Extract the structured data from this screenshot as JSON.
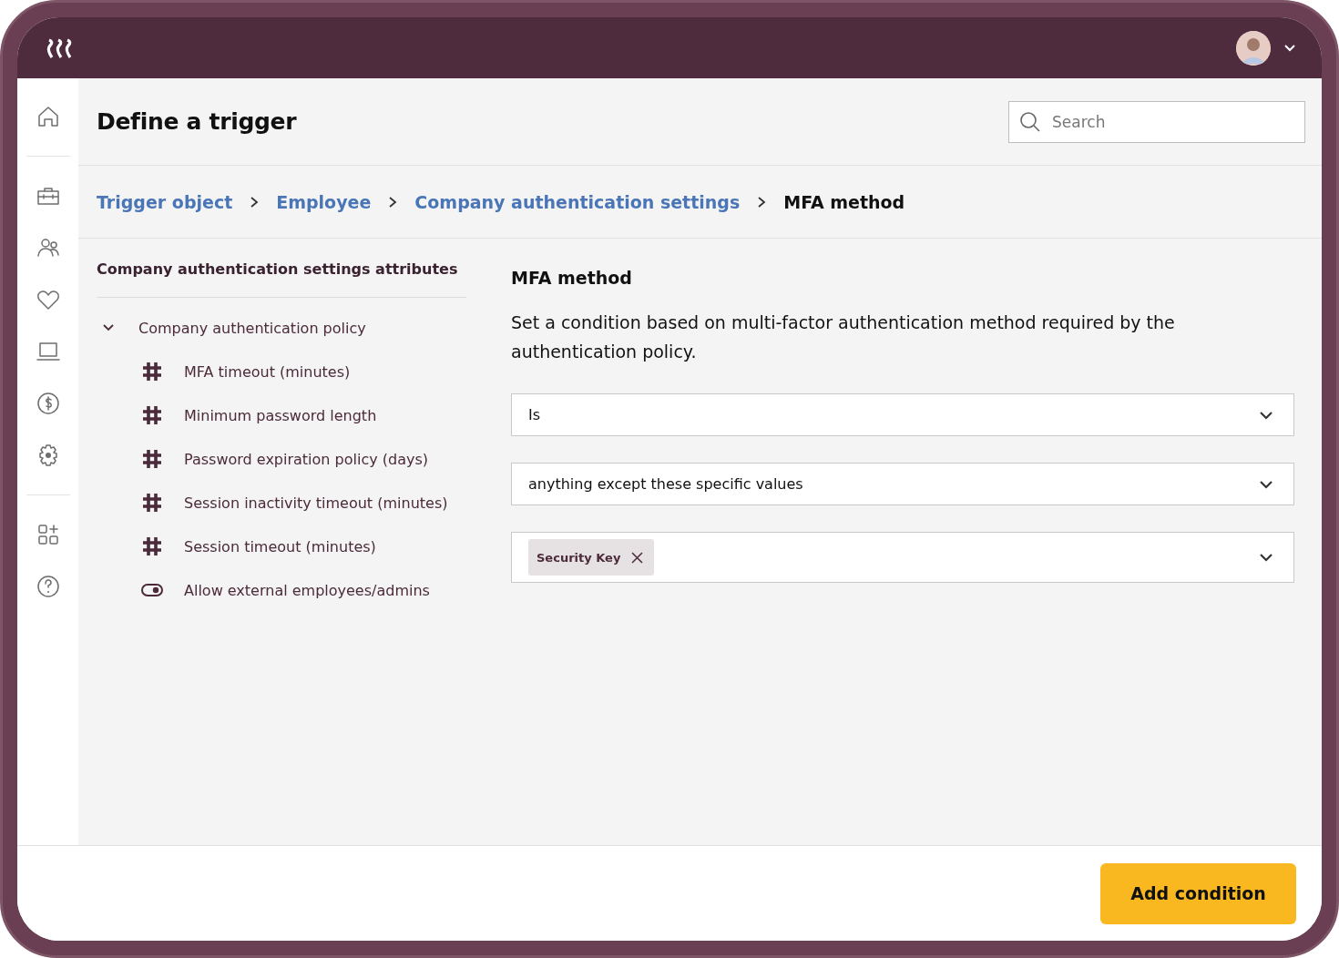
{
  "header": {
    "title": "Define a trigger",
    "search": {
      "placeholder": "Search"
    }
  },
  "breadcrumbs": [
    {
      "label": "Trigger object",
      "current": false
    },
    {
      "label": "Employee",
      "current": false
    },
    {
      "label": "Company authentication settings",
      "current": false
    },
    {
      "label": "MFA method",
      "current": true
    }
  ],
  "attributes": {
    "heading": "Company authentication settings attributes",
    "groups": [
      {
        "label": "Company authentication policy",
        "expanded": true,
        "children": [
          {
            "label": "MFA timeout (minutes)",
            "kind": "number"
          },
          {
            "label": "Minimum password length",
            "kind": "number"
          },
          {
            "label": "Password expiration policy (days)",
            "kind": "number"
          },
          {
            "label": "Session inactivity timeout (minutes)",
            "kind": "number"
          },
          {
            "label": "Session timeout (minutes)",
            "kind": "number"
          },
          {
            "label": "Allow external employees/admins",
            "kind": "toggle"
          }
        ]
      }
    ]
  },
  "condition": {
    "title": "MFA method",
    "description": "Set a condition based on multi-factor authentication method required by the authentication policy.",
    "fields": [
      {
        "kind": "select",
        "value": "Is"
      },
      {
        "kind": "select",
        "value": "anything except these specific values"
      },
      {
        "kind": "multi",
        "tags": [
          "Security Key"
        ]
      }
    ]
  },
  "footer": {
    "button": "Add condition"
  }
}
